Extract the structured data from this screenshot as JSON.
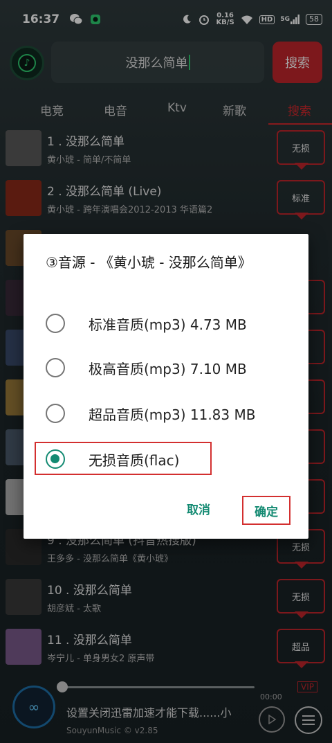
{
  "status_bar": {
    "time": "16:37",
    "net_speed_value": "0.16",
    "net_speed_unit": "KB/S",
    "hd_label": "HD",
    "signal_label": "5G",
    "battery": "58"
  },
  "search": {
    "query": "没那么简单",
    "button_label": "搜索"
  },
  "tabs": [
    {
      "label": "电竞"
    },
    {
      "label": "电音"
    },
    {
      "label": "Ktv"
    },
    {
      "label": "新歌"
    },
    {
      "label": "搜索",
      "active": true
    }
  ],
  "songs": [
    {
      "title": "1 . 没那么简单",
      "subtitle": "黄小琥 - 简单/不简单",
      "quality": "无损",
      "thumb_color": "#5a5a5a"
    },
    {
      "title": "2 . 没那么简单 (Live)",
      "subtitle": "黄小琥 - 跨年演唱会2012-2013 华语篇2",
      "quality": "标准",
      "thumb_color": "#8a2a1a"
    },
    {
      "title": "",
      "subtitle": "",
      "quality": "",
      "thumb_color": "#6a4a2a"
    },
    {
      "title": "",
      "subtitle": "",
      "quality": "",
      "thumb_color": "#3a2a3a"
    },
    {
      "title": "",
      "subtitle": "",
      "quality": "",
      "thumb_color": "#3a4a6a"
    },
    {
      "title": "",
      "subtitle": "",
      "quality": "",
      "thumb_color": "#9a7a3a"
    },
    {
      "title": "",
      "subtitle": "",
      "quality": "",
      "thumb_color": "#4a5a6a"
    },
    {
      "title": "",
      "subtitle": "",
      "quality": "",
      "thumb_color": "#b0b0b0"
    },
    {
      "title": "9 . 没那么简单 (抖音热搜版)",
      "subtitle": "王多多 - 没那么简单《黄小琥》",
      "quality": "无损",
      "thumb_color": "#2a2a2a"
    },
    {
      "title": "10 . 没那么简单",
      "subtitle": "胡彦斌 - 太歌",
      "quality": "无损",
      "thumb_color": "#3a3a3a"
    },
    {
      "title": "11 . 没那么简单",
      "subtitle": "岑宁儿 - 单身男女2 原声带",
      "quality": "超品",
      "thumb_color": "#7a5a8a"
    }
  ],
  "player": {
    "time": "00:00",
    "vip_label": "VIP",
    "marquee": "设置关闭迅雷加速才能下载......小",
    "version": "SouyunMusic © v2.85"
  },
  "dialog": {
    "title": "③音源 - 《黄小琥 - 没那么简单》",
    "options": [
      {
        "label": "标准音质(mp3) 4.73 MB",
        "checked": false
      },
      {
        "label": "极高音质(mp3) 7.10 MB",
        "checked": false
      },
      {
        "label": "超品音质(mp3) 11.83 MB",
        "checked": false
      },
      {
        "label": "无损音质(flac)",
        "checked": true
      }
    ],
    "cancel_label": "取消",
    "ok_label": "确定"
  },
  "colors": {
    "accent_red": "#c0262b",
    "accent_teal": "#138a72"
  }
}
